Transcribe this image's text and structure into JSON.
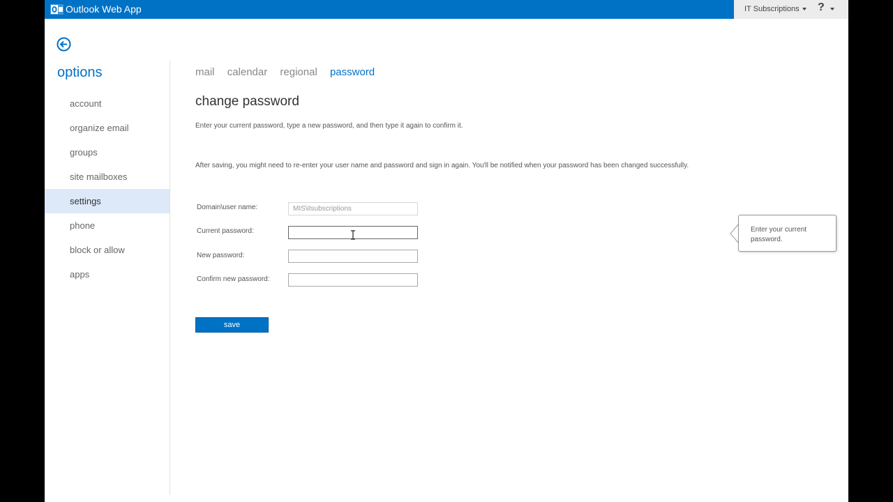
{
  "header": {
    "app_title": "Outlook Web App",
    "user_name": "IT Subscriptions",
    "help_label": "?"
  },
  "sidebar": {
    "title": "options",
    "items": [
      {
        "label": "account"
      },
      {
        "label": "organize email"
      },
      {
        "label": "groups"
      },
      {
        "label": "site mailboxes"
      },
      {
        "label": "settings"
      },
      {
        "label": "phone"
      },
      {
        "label": "block or allow"
      },
      {
        "label": "apps"
      }
    ],
    "active_item": "settings"
  },
  "tabs": [
    {
      "label": "mail"
    },
    {
      "label": "calendar"
    },
    {
      "label": "regional"
    },
    {
      "label": "password"
    }
  ],
  "active_tab": "password",
  "main": {
    "title": "change password",
    "description1": "Enter your current password, type a new password, and then type it again to confirm it.",
    "description2": "After saving, you might need to re-enter your user name and password and sign in again. You'll be notified when your password has been changed successfully.",
    "form": {
      "domain_label": "Domain\\user name:",
      "domain_value": "MIS\\itsubscriptions",
      "current_label": "Current password:",
      "current_value": "",
      "new_label": "New password:",
      "new_value": "",
      "confirm_label": "Confirm new password:",
      "confirm_value": ""
    },
    "save_label": "save"
  },
  "tooltip": {
    "text": "Enter your current password."
  },
  "colors": {
    "brand": "#0072c6",
    "active_nav_bg": "#dde9f8"
  },
  "icons": {
    "logo": "outlook-logo-icon",
    "back": "back-arrow-icon",
    "user_menu": "chevron-down-icon",
    "help": "help-icon"
  }
}
